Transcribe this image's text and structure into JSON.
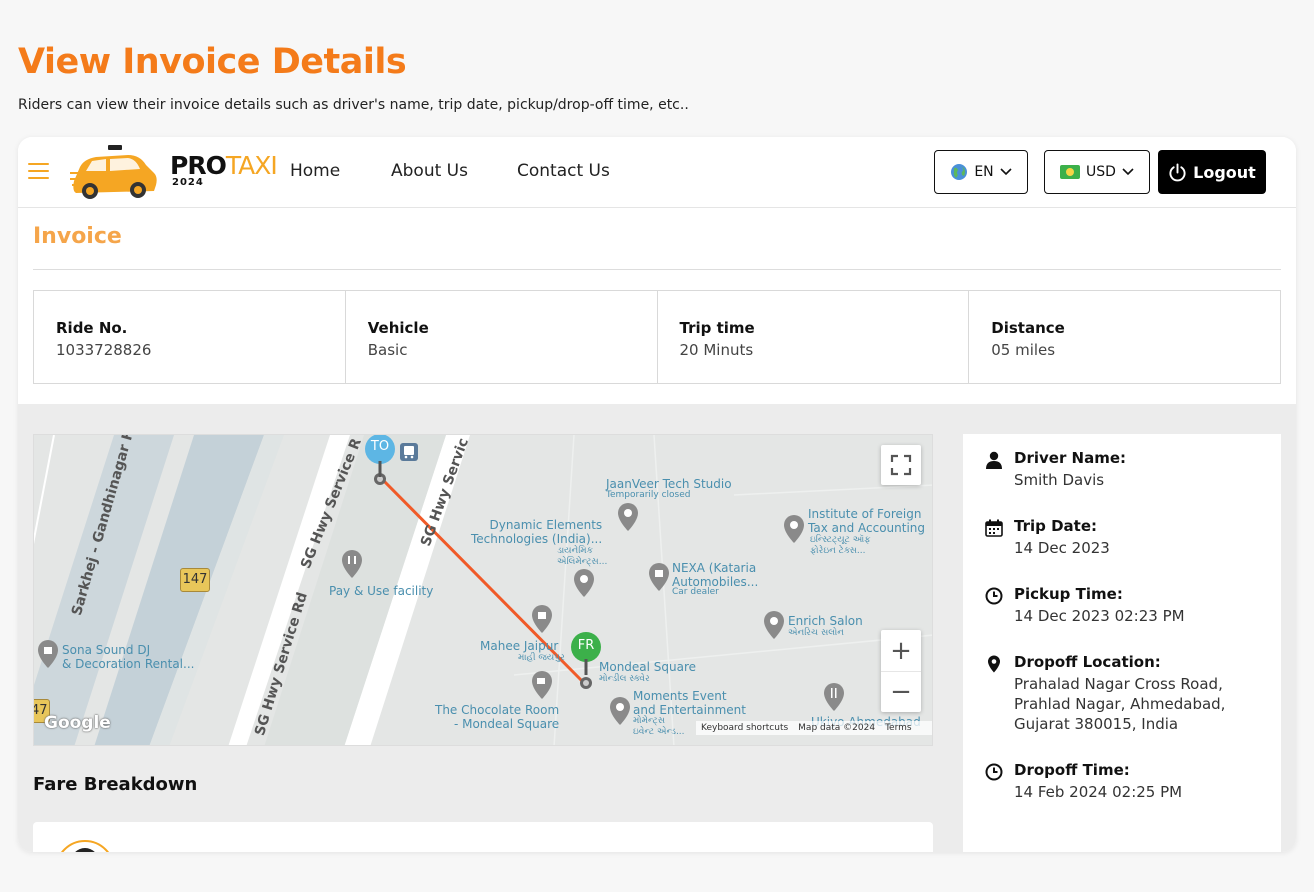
{
  "page": {
    "heading": "View Invoice Details",
    "subheading": "Riders can view their invoice details such as driver's name, trip date, pickup/drop-off time, etc.."
  },
  "navbar": {
    "logo_pro": "PRO",
    "logo_taxi": "TAXI",
    "logo_year": "2024",
    "links": [
      "Home",
      "About Us",
      "Contact Us"
    ],
    "language": "EN",
    "currency": "USD",
    "logout_label": "Logout"
  },
  "invoice": {
    "title": "Invoice",
    "stats": [
      {
        "label": "Ride No.",
        "value": "1033728826"
      },
      {
        "label": "Vehicle",
        "value": "Basic"
      },
      {
        "label": "Trip time",
        "value": "20 Minuts"
      },
      {
        "label": "Distance",
        "value": "05 miles"
      }
    ]
  },
  "map": {
    "marker_to": "TO",
    "marker_from": "FR",
    "route_badge": "147",
    "route_badge_edge": "47",
    "google_logo": "Google",
    "footer": [
      "Keyboard shortcuts",
      "Map data ©2024",
      "Terms"
    ],
    "roads": [
      "Sarkhej - Gandhinagar H",
      "SG Hwy Service R",
      "SG Hwy Servic",
      "SG Hwy Service Rd"
    ],
    "places": [
      {
        "name": "JaanVeer Tech Studio",
        "note": "Temporarily closed"
      },
      {
        "name": "Institute of Foreign\nTax and Accounting",
        "note": "ઇન્સ્ટિટ્યૂટ ઑફ\nફોરેઇન ટેક્સ..."
      },
      {
        "name": "Dynamic Elements\nTechnologies (India)...",
        "note": "ડાયનેમિક\nએલિમેન્ટ્સ..."
      },
      {
        "name": "NEXA (Kataria\nAutomobiles...",
        "note": "Car dealer"
      },
      {
        "name": "Pay & Use facility",
        "note": ""
      },
      {
        "name": "Sona Sound DJ\n& Decoration Rental...",
        "note": ""
      },
      {
        "name": "Enrich Salon",
        "note": "એનરિચ સલોન"
      },
      {
        "name": "Mahee Jaipur",
        "note": "માહી જયપુર"
      },
      {
        "name": "Mondeal Square",
        "note": "મોન્ડીલ સ્ક્વેર"
      },
      {
        "name": "Moments Event\nand Entertainment",
        "note": "મોમેન્ટ્સ\nઇવેન્ટ એન્ડ..."
      },
      {
        "name": "The Chocolate Room\n- Mondeal Square",
        "note": ""
      },
      {
        "name": "Ukiyo Ahmedabad",
        "note": ""
      }
    ]
  },
  "fare": {
    "title": "Fare Breakdown"
  },
  "details": [
    {
      "label": "Driver Name:",
      "value": "Smith Davis"
    },
    {
      "label": "Trip Date:",
      "value": "14 Dec 2023"
    },
    {
      "label": "Pickup Time:",
      "value": "14 Dec 2023 02:23 PM"
    },
    {
      "label": "Dropoff Location:",
      "value": "Prahalad Nagar Cross Road, Prahlad Nagar, Ahmedabad, Gujarat 380015, India"
    },
    {
      "label": "Dropoff Time:",
      "value": "14 Feb 2024 02:25 PM"
    }
  ],
  "colors": {
    "accent": "#f47b1a",
    "brand_yellow": "#f5a623",
    "route": "#f05a28",
    "marker_to": "#5db6e4",
    "marker_from": "#3cb04a"
  }
}
